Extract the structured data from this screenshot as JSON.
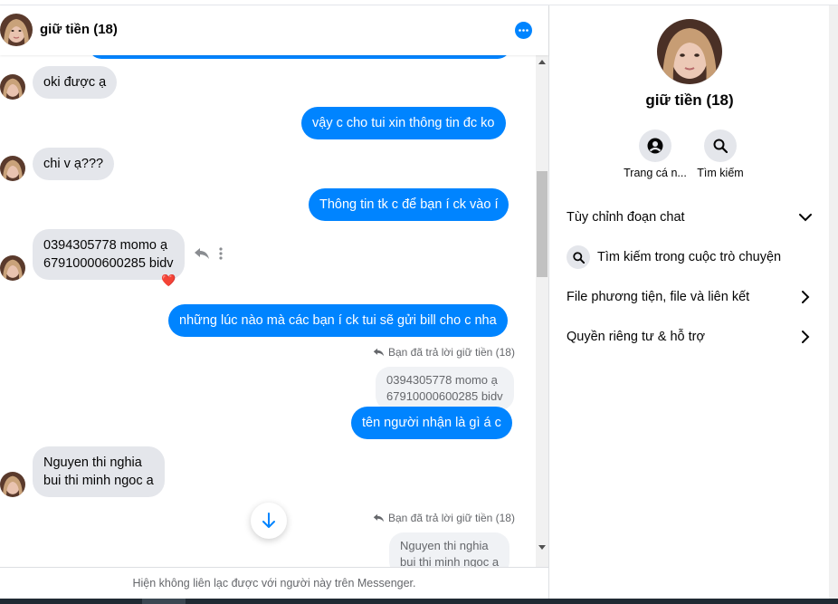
{
  "conversation": {
    "title": "giữ tiền (18)",
    "footer_notice": "Hiện không liên lạc được với người này trên Messenger."
  },
  "messages": {
    "m1": "oki được ạ",
    "m2": "vậy c cho tui xin thông tin đc ko",
    "m3": "chi v ạ???",
    "m4": "Thông tin tk c để bạn í ck vào í",
    "m5_line1": "0394305778 momo ạ",
    "m5_line2": "67910000600285 bidv",
    "m5_reaction": "❤️",
    "m6": "những lúc nào mà các bạn í ck tui sẽ gửi bill cho c nha",
    "reply1_note": "Bạn đã trả lời giữ tiền (18)",
    "reply1_quote_line1": "0394305778 momo ạ",
    "reply1_quote_line2": "67910000600285 bidv",
    "m7": "tên người nhận là gì á c",
    "m8_line1": "Nguyen thi nghia",
    "m8_line2": "bui thi minh ngoc a",
    "reply2_note": "Bạn đã trả lời giữ tiền (18)",
    "reply2_quote_line1": "Nguyen thi nghia",
    "reply2_quote_line2": "bui thi minh ngoc a"
  },
  "info_panel": {
    "name": "giữ tiền (18)",
    "actions": [
      {
        "label": "Trang cá n...",
        "icon": "profile-icon"
      },
      {
        "label": "Tìm kiếm",
        "icon": "search-icon"
      }
    ],
    "menu": {
      "customize": "Tùy chỉnh đoạn chat",
      "search_in_chat": "Tìm kiếm trong cuộc trò chuyện",
      "media": "File phương tiện, file và liên kết",
      "privacy": "Quyền riêng tư & hỗ trợ"
    }
  },
  "colors": {
    "accent": "#0084ff",
    "incoming_bubble": "#e4e6eb",
    "muted_text": "#65676b"
  }
}
